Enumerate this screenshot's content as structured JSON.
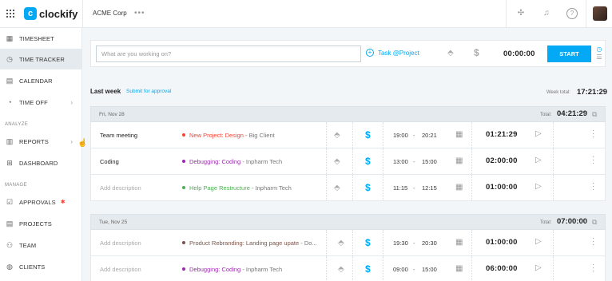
{
  "header": {
    "app_name": "clockify",
    "workspace": "ACME Corp",
    "more": "•••",
    "help": "?"
  },
  "sidebar": {
    "items": [
      {
        "label": "TIMESHEET",
        "icon": "timesheet-icon"
      },
      {
        "label": "TIME TRACKER",
        "icon": "clock-icon",
        "active": true
      },
      {
        "label": "CALENDAR",
        "icon": "calendar-icon"
      },
      {
        "label": "TIME OFF",
        "icon": "time-off-icon",
        "chevron": true
      }
    ],
    "analyze_label": "ANALYZE",
    "analyze_items": [
      {
        "label": "REPORTS",
        "icon": "reports-icon",
        "chevron": true
      },
      {
        "label": "DASHBOARD",
        "icon": "dashboard-icon"
      }
    ],
    "manage_label": "MANAGE",
    "manage_items": [
      {
        "label": "APPROVALS",
        "icon": "approvals-icon",
        "badge": true
      },
      {
        "label": "PROJECTS",
        "icon": "projects-icon"
      },
      {
        "label": "TEAM",
        "icon": "team-icon"
      },
      {
        "label": "CLIENTS",
        "icon": "clients-icon"
      }
    ]
  },
  "tracker": {
    "placeholder": "What are you working on?",
    "project_button": "Task @Project",
    "duration": "00:00:00",
    "start_label": "START"
  },
  "week": {
    "title": "Last week",
    "submit_label": "Submit for approval",
    "total_label": "Week total:",
    "total": "17:21:29"
  },
  "groups": [
    {
      "date": "Fri, Nov 28",
      "total_label": "Total:",
      "total": "04:21:29",
      "entries": [
        {
          "description": "Team meeting",
          "is_placeholder": false,
          "project": "New Project: Design",
          "project_color": "#f44336",
          "client": "- Big Client",
          "start": "19:00",
          "end": "20:21",
          "duration": "01:21:29"
        },
        {
          "description": "Coding",
          "is_placeholder": false,
          "project": "Debugging: Coding",
          "project_color": "#9c27b0",
          "client": "- Inpharm Tech",
          "start": "13:00",
          "end": "15:00",
          "duration": "02:00:00"
        },
        {
          "description": "Add description",
          "is_placeholder": true,
          "project": "Help Page Restructure",
          "project_color": "#4caf50",
          "client": "- Inpharm Tech",
          "start": "11:15",
          "end": "12:15",
          "duration": "01:00:00"
        }
      ]
    },
    {
      "date": "Tue, Nov 25",
      "total_label": "Total:",
      "total": "07:00:00",
      "entries": [
        {
          "description": "Add description",
          "is_placeholder": true,
          "project": "Product Rebranding: Landing page upate",
          "project_color": "#795548",
          "client": "- Do...",
          "start": "19:30",
          "end": "20:30",
          "duration": "01:00:00"
        },
        {
          "description": "Add description",
          "is_placeholder": true,
          "project": "Debugging: Coding",
          "project_color": "#9c27b0",
          "client": "- Inpharm Tech",
          "start": "09:00",
          "end": "15:00",
          "duration": "06:00:00"
        }
      ]
    }
  ],
  "colors": {
    "accent": "#03a9f4",
    "sidebar_active": "#e4eaee",
    "background": "#f2f6f8"
  }
}
